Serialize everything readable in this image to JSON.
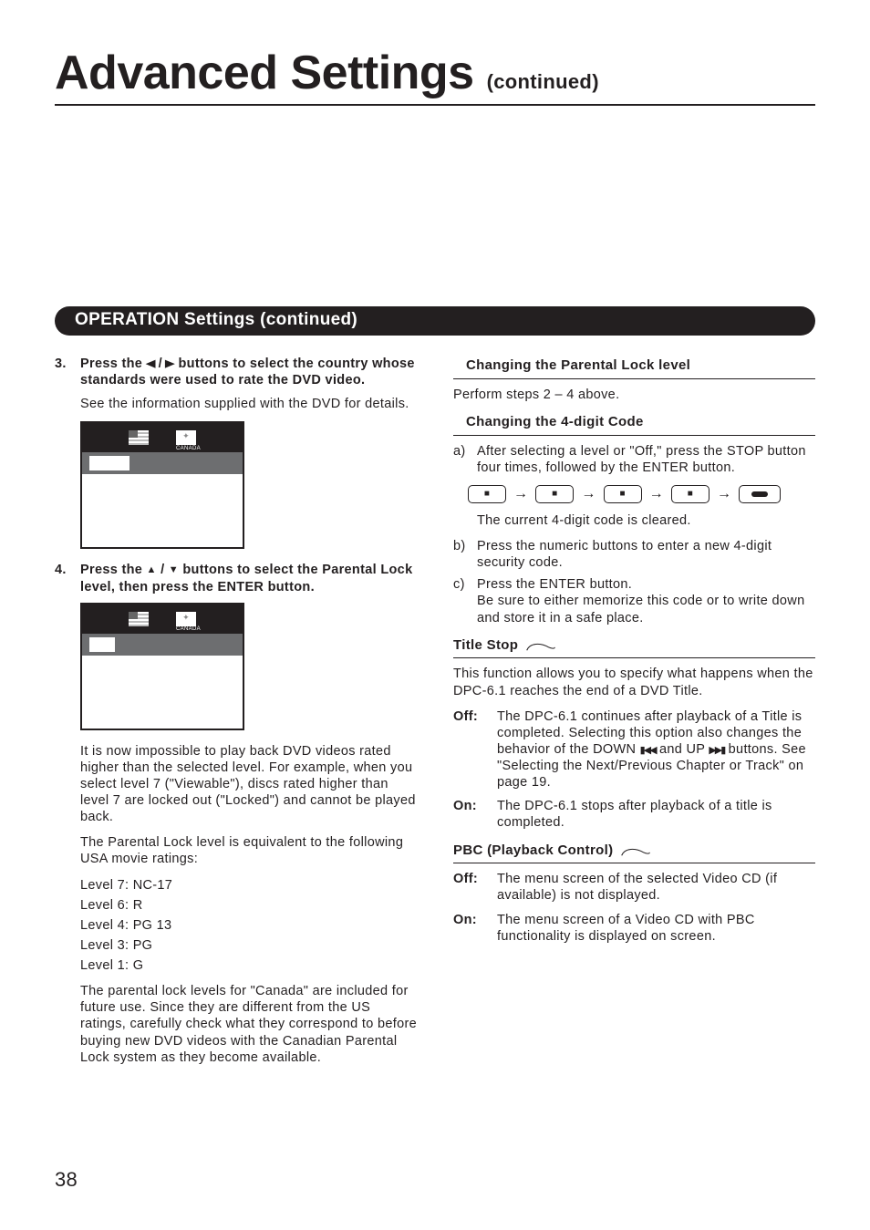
{
  "title": {
    "main": "Advanced Settings ",
    "sub": "(continued)"
  },
  "section_bar": "OPERATION Settings (continued)",
  "left": {
    "step3": {
      "num": "3.",
      "text_a": "Press the ",
      "text_b": " / ",
      "text_c": " buttons to select the country whose standards were used to rate the DVD video."
    },
    "step3_note": "See the information supplied with the DVD for details.",
    "step4": {
      "num": "4.",
      "text_a": "Press the ",
      "text_b": " / ",
      "text_c": "  buttons to select the Parental Lock level, then press the ENTER button."
    },
    "para_locked": "It is now impossible to play back DVD videos rated higher than the selected level. For example, when you select level 7 (\"Viewable\"), discs rated higher than level 7 are locked out (\"Locked\") and cannot be played back.",
    "para_equiv": "The Parental Lock level is equivalent to the following USA movie ratings:",
    "levels": {
      "l7": "Level 7: NC-17",
      "l6": "Level 6: R",
      "l4": "Level 4: PG 13",
      "l3": "Level 3: PG",
      "l1": "Level 1: G"
    },
    "para_canada": "The parental lock levels for \"Canada\" are included for future use. Since they are different from the US ratings, carefully check what they correspond to before buying new DVD videos with the Canadian Parental Lock system as they become available."
  },
  "right": {
    "h_change_level": "Changing the Parental Lock level",
    "p_perform": "Perform steps 2 – 4 above.",
    "h_change_code": "Changing the 4-digit Code",
    "li_a_key": "a)",
    "li_a": "After selecting a level or \"Off,\" press the STOP button four times, followed by the ENTER button.",
    "p_cleared": "The current 4-digit code is cleared.",
    "li_b_key": "b)",
    "li_b": "Press the numeric buttons to enter a new 4-digit security code.",
    "li_c_key": "c)",
    "li_c1": "Press the ENTER button.",
    "li_c2": "Be sure to either memorize this code or to write down and store it in a safe place.",
    "h_title_stop": "Title Stop",
    "p_ts": "This function allows you to specify what happens when the DPC-6.1 reaches the end of a DVD Title.",
    "ts_off_key": "Off:",
    "ts_off_a": "The DPC-6.1 continues after playback of a Title is completed. Selecting this option also changes the behavior of the DOWN ",
    "ts_off_b": " and UP ",
    "ts_off_c": " buttons. See \"Selecting the Next/Previous Chapter or Track\" on page 19.",
    "ts_on_key": "On:",
    "ts_on": "The DPC-6.1 stops after playback of a title is completed.",
    "h_pbc": "PBC (Playback Control)",
    "pbc_off_key": "Off:",
    "pbc_off": "The menu screen of the selected Video CD (if available) is not displayed.",
    "pbc_on_key": "On:",
    "pbc_on": "The menu screen of a Video CD with PBC functionality is displayed on screen."
  },
  "pagenum": "38"
}
